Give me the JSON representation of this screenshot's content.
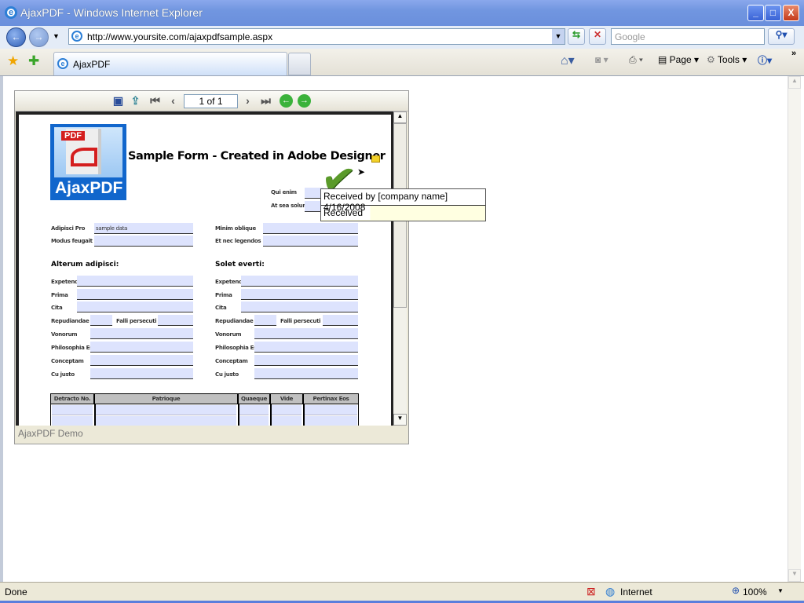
{
  "window": {
    "title": "AjaxPDF - Windows Internet Explorer",
    "min": "_",
    "max": "□",
    "close": "X"
  },
  "nav": {
    "url": "http://www.yoursite.com/ajaxpdfsample.aspx",
    "search_placeholder": "Google"
  },
  "tabs": {
    "active": "AjaxPDF"
  },
  "commands": {
    "page": "Page",
    "tools": "Tools",
    "chevron": "»"
  },
  "status": {
    "text": "Done",
    "zone": "Internet",
    "zoom": "100%"
  },
  "viewer": {
    "page_indicator": "1 of 1",
    "footer": "AjaxPDF Demo"
  },
  "form": {
    "logo_badge": "PDF",
    "logo_text": "AjaxPDF",
    "title": "Sample Form - Created in Adobe Designer",
    "qui_enim": "Qui enim",
    "at_sea_solum": "At sea solum",
    "adipisci_pro": "Adipisci Pro",
    "adipisci_value": "sample data",
    "modus_feugait": "Modus feugait",
    "minim_oblique": "Minim oblique",
    "et_nec_legendos": "Et nec legendos",
    "left_heading": "Alterum adipisci:",
    "right_heading": "Solet everti:",
    "rows": [
      "Expetenda",
      "Prima",
      "Cita",
      "Repudiandae",
      "Vonorum",
      "Philosophia Est",
      "Conceptam",
      "Cu justo"
    ],
    "falli": "Falli persecuti",
    "table_headers": [
      "Detracto  No.",
      "Patrioque",
      "Quaeque",
      "Vide",
      "Pertinax Eos"
    ]
  },
  "tooltip": {
    "title": "Received by [company name] 4/16/2008",
    "status": "Received"
  }
}
